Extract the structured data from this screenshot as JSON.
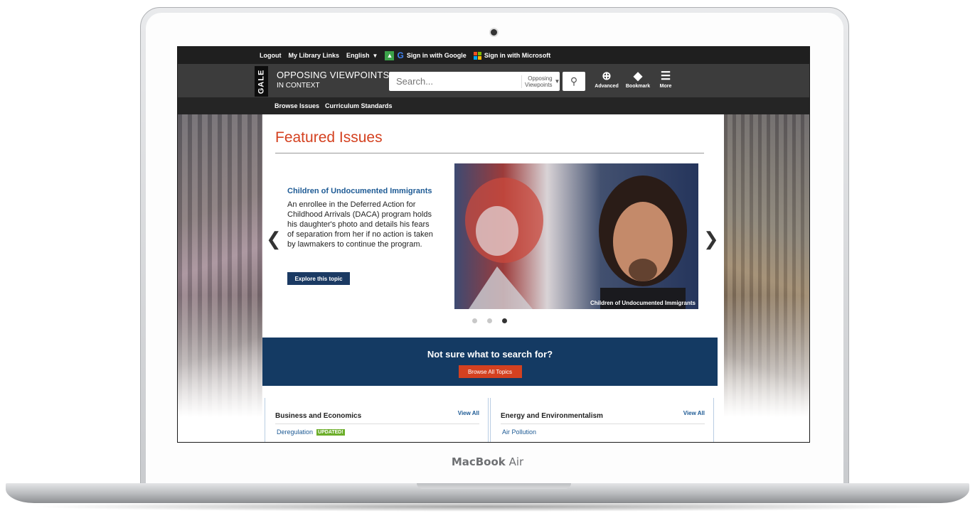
{
  "device": {
    "brand_bold": "MacBook",
    "brand_light": "Air"
  },
  "utilbar": {
    "logout": "Logout",
    "library_links": "My Library Links",
    "language": "English",
    "google_signin": "Sign in with Google",
    "microsoft_signin": "Sign in with Microsoft"
  },
  "header": {
    "gale": "GALE",
    "title_line1": "OPPOSING VIEWPOINTS",
    "title_line2": "IN CONTEXT",
    "search_placeholder": "Search...",
    "scope_line1": "Opposing",
    "scope_line2": "Viewpoints",
    "advanced": "Advanced",
    "bookmark": "Bookmark",
    "more": "More"
  },
  "browse": {
    "issues": "Browse Issues",
    "standards": "Curriculum Standards"
  },
  "featured": {
    "heading": "Featured Issues",
    "slide_title": "Children of Undocumented Immigrants",
    "slide_desc": "An enrollee in the Deferred Action for Childhood Arrivals (DACA) program holds his daughter's photo and details his fears of separation from her if no action is taken by lawmakers to continue the program.",
    "explore": "Explore this topic",
    "caption": "Children of Undocumented Immigrants",
    "active_slide": 3,
    "slide_count": 3
  },
  "notsure": {
    "question": "Not sure what to search for?",
    "button": "Browse All Topics"
  },
  "cards": [
    {
      "title": "Business and Economics",
      "view_all": "View All",
      "first_item": "Deregulation",
      "badge": "UPDATED!"
    },
    {
      "title": "Energy and Environmentalism",
      "view_all": "View All",
      "first_item": "Air Pollution"
    }
  ],
  "colors": {
    "accent_red": "#d44120",
    "navy": "#143a63",
    "link_blue": "#1d5a94",
    "badge_green": "#6cae2a"
  }
}
